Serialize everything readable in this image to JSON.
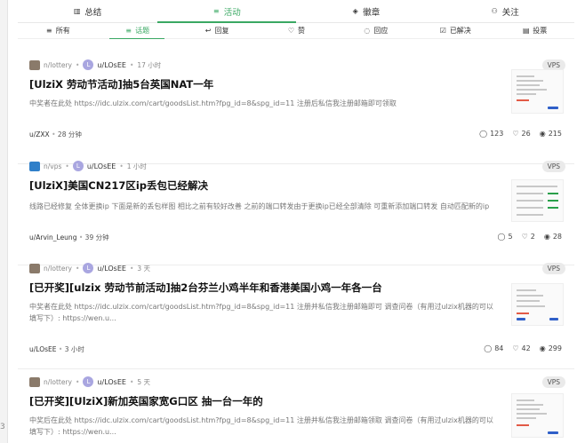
{
  "main_tabs": [
    {
      "icon": "chart-icon",
      "label": "总结"
    },
    {
      "icon": "list-icon",
      "label": "活动"
    },
    {
      "icon": "badge-icon",
      "label": "徽章"
    },
    {
      "icon": "users-icon",
      "label": "关注"
    }
  ],
  "activity_tabs": [
    {
      "label": "所有"
    },
    {
      "label": "话题"
    },
    {
      "label": "回复"
    },
    {
      "label": "赞"
    },
    {
      "label": "回应"
    },
    {
      "label": "已解决"
    },
    {
      "label": "投票"
    }
  ],
  "posts": [
    {
      "node": "n/lottery",
      "author": "u/LOsEE",
      "time": "17 小时",
      "tag": "VPS",
      "title": "[UlziX 劳动节活动]抽5台英国NAT一年",
      "excerpt": "中奖者在此处 https://idc.ulzix.com/cart/goodsList.htm?fpg_id=8&spg_id=11 注册后私信我注册邮箱即可领取",
      "last_user": "u/ZXX",
      "last_time": "28 分钟",
      "replies": "123",
      "likes": "26",
      "views": "215"
    },
    {
      "node": "n/vps",
      "author": "u/LOsEE",
      "time": "1 小时",
      "tag": "VPS",
      "title": "[UlziX]美国CN217区ip丢包已经解决",
      "excerpt": "线路已经修复 全体更换ip 下面是新的丢包样图 相比之前有较好改善 之前的端口转发由于更换ip已经全部清除 可重新添加端口转发 自动匹配新的ip",
      "last_user": "u/Arvin_Leung",
      "last_time": "39 分钟",
      "replies": "5",
      "likes": "2",
      "views": "28"
    },
    {
      "node": "n/lottery",
      "author": "u/LOsEE",
      "time": "3 天",
      "tag": "VPS",
      "title": "[已开奖][ulzix 劳动节前活动]抽2台芬兰小鸡半年和香港美国小鸡一年各一台",
      "excerpt": "中奖者在此处 https://idc.ulzix.com/cart/goodsList.htm?fpg_id=8&spg_id=11 注册并私信我注册邮箱即可 调查问卷（有用过ulzix机器的可以填写下）: https://wen.u...",
      "last_user": "u/LOsEE",
      "last_time": "3 小时",
      "replies": "84",
      "likes": "42",
      "views": "299"
    },
    {
      "node": "n/lottery",
      "author": "u/LOsEE",
      "time": "5 天",
      "tag": "VPS",
      "title": "[已开奖][UlziX]新加英国家宽G口区 抽一台一年的",
      "excerpt": "中奖后在此处 https://idc.ulzix.com/cart/goodsList.htm?fpg_id=8&spg_id=11 注册并私信我注册邮箱领取 调查问卷（有用过ulzix机器的可以填写下）: https://wen.u...",
      "last_user": "",
      "last_time": "",
      "replies": "",
      "likes": "",
      "views": ""
    }
  ],
  "edge_mark": "3",
  "colors": {
    "accent": "#3aa863",
    "avatar": "#a9a6e0",
    "tag_bg": "#eaeaea"
  }
}
